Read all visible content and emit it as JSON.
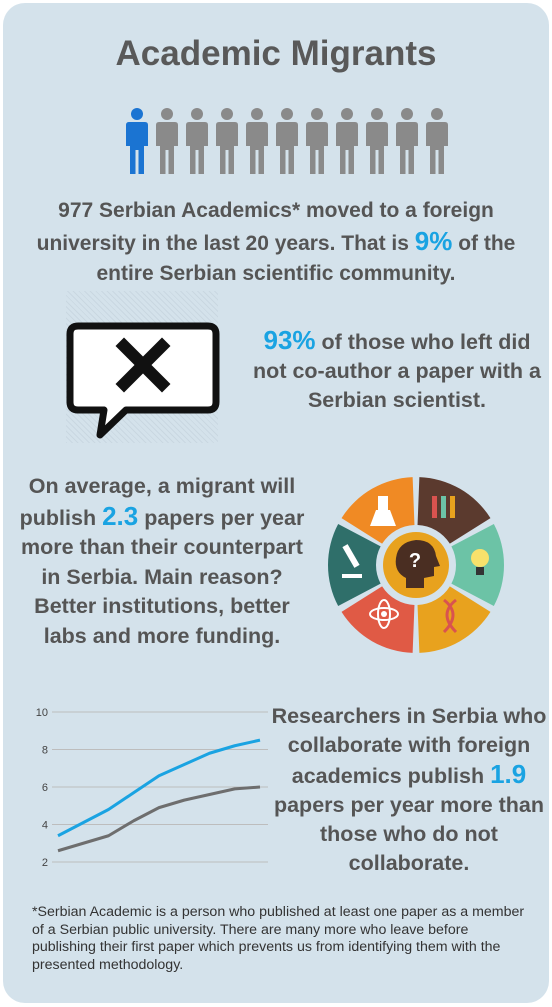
{
  "title": "Academic Migrants",
  "people_icon": {
    "total": 11,
    "highlighted": 1,
    "highlight_color": "#1b74d2",
    "base_color": "#8a8a8a"
  },
  "stat1": {
    "pre": "977 Serbian Academics* moved to a foreign university in the last 20 years. That is ",
    "value": "9%",
    "post": " of the entire Serbian  scientific community."
  },
  "stat2": {
    "value": "93%",
    "post": " of those who left did not co-author a paper with a Serbian scientist.",
    "icon": "no-collaboration-speech-bubble-icon"
  },
  "stat3": {
    "pre": "On average, a migrant will publish ",
    "value": "2.3",
    "post": " papers per year more than their counterpart in Serbia. Main reason? Better institutions, better labs and more funding.",
    "icon": "science-wheel-icon"
  },
  "stat4": {
    "pre": "Researchers in Serbia who collaborate with foreign academics publish ",
    "value": "1.9",
    "post": " papers per year more than those who do not collaborate."
  },
  "footnote": "*Serbian Academic is a person who published at least one paper as a member of a Serbian public university. There are many more who leave before publishing their first paper which prevents us from identifying them with the presented methodology.",
  "colors": {
    "accent": "#1aa3e2",
    "text": "#555555",
    "background": "#d4e2eb"
  },
  "chart_data": {
    "type": "line",
    "x": [
      0,
      1,
      2,
      3,
      4,
      5,
      6,
      7,
      8
    ],
    "series": [
      {
        "values": [
          3.4,
          4.1,
          4.8,
          5.7,
          6.6,
          7.2,
          7.8,
          8.2,
          8.5
        ],
        "color": "#1aa3e2"
      },
      {
        "values": [
          2.6,
          3.0,
          3.4,
          4.2,
          4.9,
          5.3,
          5.6,
          5.9,
          6.0
        ],
        "color": "#6e6e6e"
      }
    ],
    "yticks": [
      "2",
      "4",
      "6",
      "8",
      "10"
    ],
    "ylim": [
      2,
      10
    ],
    "grid": true
  }
}
